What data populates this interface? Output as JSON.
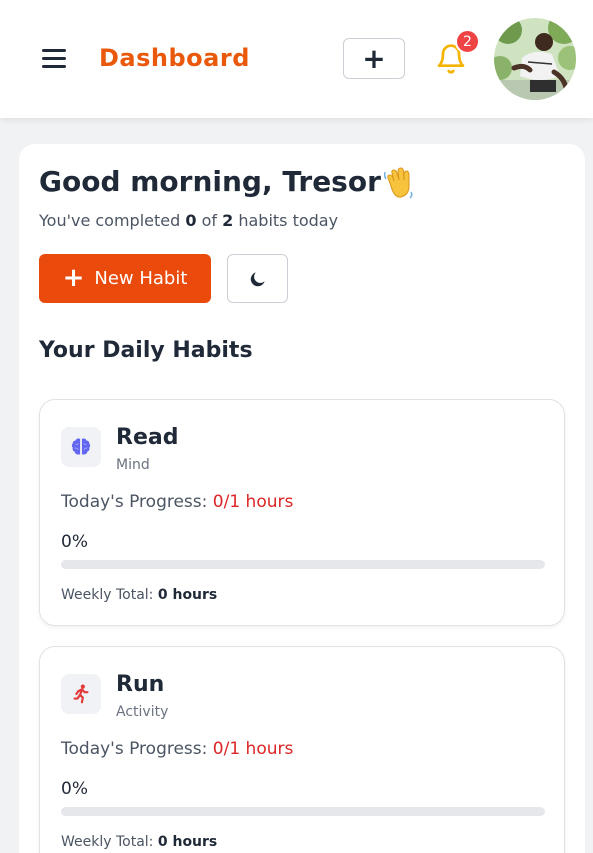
{
  "header": {
    "title": "Dashboard",
    "add_label": "+",
    "notification_count": "2"
  },
  "greeting": {
    "text": "Good morning, Tresor",
    "prefix": "You've completed",
    "completed": "0",
    "of": "of",
    "total": "2",
    "suffix": "habits today"
  },
  "actions": {
    "new_habit_plus": "+",
    "new_habit_label": "New Habit"
  },
  "section": {
    "title": "Your Daily Habits"
  },
  "habits": [
    {
      "name": "Read",
      "category": "Mind",
      "progress_label": "Today's Progress:",
      "progress_value": "0/1 hours",
      "percent_text": "0%",
      "percent": 0,
      "weekly_label": "Weekly Total:",
      "weekly_value": "0 hours",
      "icon": "brain-icon"
    },
    {
      "name": "Run",
      "category": "Activity",
      "progress_label": "Today's Progress:",
      "progress_value": "0/1 hours",
      "percent_text": "0%",
      "percent": 0,
      "weekly_label": "Weekly Total:",
      "weekly_value": "0 hours",
      "icon": "running-icon"
    }
  ],
  "colors": {
    "brand": "#ea580c",
    "primary_button": "#ea4a0c",
    "progress_value": "#dc2626",
    "badge": "#ef4444",
    "bell": "#f5b301",
    "brain": "#6366f1",
    "runner": "#e23b3b"
  }
}
